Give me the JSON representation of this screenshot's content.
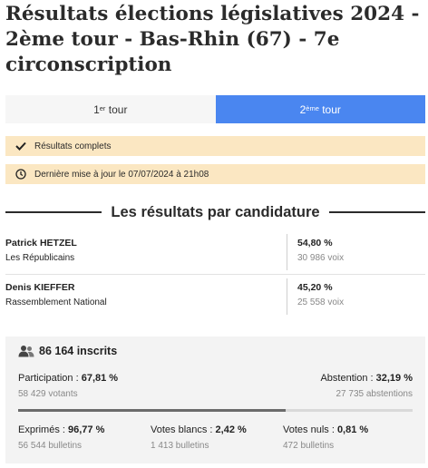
{
  "page": {
    "title": "Résultats élections législatives 2024 - 2ème tour - Bas-Rhin (67) - 7e circonscription"
  },
  "tabs": [
    {
      "label_main": "1",
      "label_sup": "er",
      "label_rest": " tour",
      "active": false
    },
    {
      "label_main": "2",
      "label_sup": "ème",
      "label_rest": " tour",
      "active": true
    }
  ],
  "notices": {
    "complete": {
      "icon": "check-icon",
      "text": "Résultats complets"
    },
    "updated": {
      "icon": "clock-icon",
      "text": "Dernière mise à jour le 07/07/2024 à 21h08"
    }
  },
  "results_section": {
    "heading": "Les résultats par candidature"
  },
  "candidates": [
    {
      "name": "Patrick HETZEL",
      "party": "Les Républicains",
      "pct": "54,80 %",
      "votes": "30 986 voix"
    },
    {
      "name": "Denis KIEFFER",
      "party": "Rassemblement National",
      "pct": "45,20 %",
      "votes": "25 558 voix"
    }
  ],
  "stats": {
    "icon": "people-icon",
    "registered": "86 164 inscrits",
    "participation": {
      "label": "Participation : ",
      "value": "67,81 %",
      "sub": "58 429 votants",
      "fraction": 0.6781
    },
    "abstention": {
      "label": "Abstention : ",
      "value": "32,19 %",
      "sub": "27 735 abstentions"
    },
    "expressed": {
      "label": "Exprimés : ",
      "value": "96,77 %",
      "sub": "56 544 bulletins"
    },
    "blank": {
      "label": "Votes blancs : ",
      "value": "2,42 %",
      "sub": "1 413 bulletins"
    },
    "null": {
      "label": "Votes nuls : ",
      "value": "0,81 %",
      "sub": "472 bulletins"
    }
  },
  "colors": {
    "accent": "#4a86f0",
    "notice_bg": "#fbe7c2",
    "stats_bg": "#f3f3f3"
  }
}
